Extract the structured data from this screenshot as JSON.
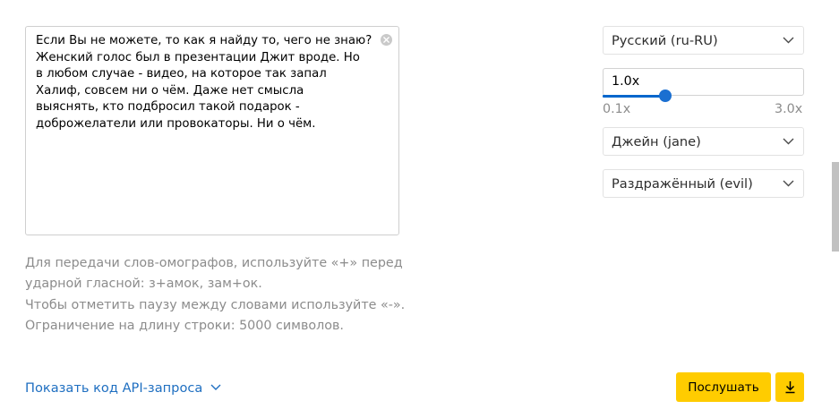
{
  "editor": {
    "lines": [
      "Если Вы не можете, то как я найду то, чего не знаю?",
      "Женский голос был в презентации Джит вроде. Но",
      "в любом случае - видео, на которое так запал",
      "Халиф, совсем ни о чём. Даже нет смысла",
      "выяснять, кто подбросил такой подарок -",
      "доброжелатели или провокаторы. Ни о чём."
    ]
  },
  "hints": [
    "Для передачи слов-омографов, используйте «+» перед",
    "ударной гласной: з+амок, зам+ок.",
    "Чтобы отметить паузу между словами используйте «-».",
    "Ограничение на длину строки: 5000 символов."
  ],
  "settings": {
    "language": "Русский (ru-RU)",
    "speed_value": "1.0x",
    "speed_fraction": 0.31,
    "speed_min": "0.1x",
    "speed_max": "3.0x",
    "voice": "Джейн (jane)",
    "emotion": "Раздражённый (evil)"
  },
  "actions": {
    "api_link": "Показать код API-запроса",
    "listen": "Послушать"
  },
  "colors": {
    "accent_yellow": "#ffcc00",
    "link_blue": "#1f6fc1",
    "slider_blue": "#1a6fd1",
    "hint_gray": "#8c8c8c"
  },
  "icons": [
    "close-icon",
    "chevron-down-icon",
    "download-icon"
  ]
}
